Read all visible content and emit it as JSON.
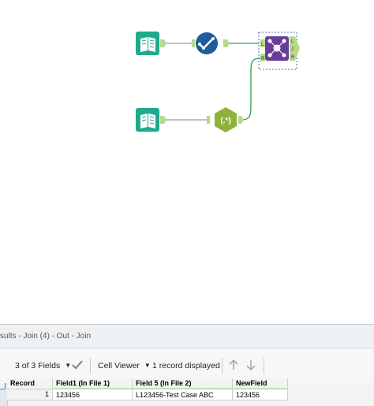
{
  "canvas": {
    "tools": [
      {
        "name": "input-data-tool-1",
        "icon": "book-icon"
      },
      {
        "name": "select-tool",
        "icon": "checkmark-icon"
      },
      {
        "name": "join-tool",
        "icon": "join-icon",
        "anchors": [
          "L",
          "J",
          "R",
          "L",
          "R"
        ]
      },
      {
        "name": "input-data-tool-2",
        "icon": "book-icon"
      },
      {
        "name": "formula-tool",
        "icon": "formula-icon",
        "label": "(.*)"
      }
    ],
    "colors": {
      "input": "#1fa98d",
      "select": "#1f5c99",
      "join": "#6a3d9a",
      "formula": "#8db33b",
      "connector_gray": "#9a9a9a",
      "connector_green": "#2aa14a"
    }
  },
  "results": {
    "title": "sults - Join (4) - Out - Join",
    "toolbar": {
      "fields_label": "3 of 3 Fields",
      "cell_viewer_label": "Cell Viewer",
      "records_label": "1 record displayed"
    },
    "table": {
      "columns": [
        "Record",
        "Field1 (In File 1)",
        "Field 5 (In File 2)",
        "NewField"
      ],
      "rows": [
        [
          "1",
          "123456",
          "L123456-Test Case ABC",
          "123456"
        ]
      ]
    }
  }
}
